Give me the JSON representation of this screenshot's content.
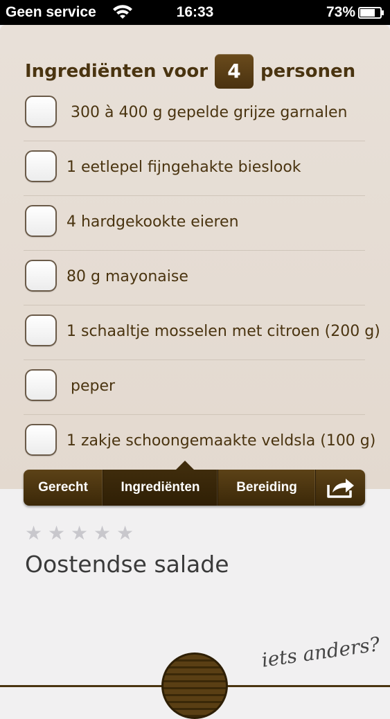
{
  "status_bar": {
    "carrier": "Geen service",
    "time": "16:33",
    "battery": "73%"
  },
  "heading": {
    "prefix": "Ingrediënten voor",
    "persons": "4",
    "suffix": "personen"
  },
  "ingredients": [
    {
      "text": "300 à 400 g gepelde grijze garnalen",
      "checked": false
    },
    {
      "text": "1 eetlepel fijngehakte bieslook",
      "checked": false
    },
    {
      "text": "4 hardgekookte eieren",
      "checked": false
    },
    {
      "text": "80 g mayonaise",
      "checked": false
    },
    {
      "text": "1 schaaltje mosselen met citroen (200 g)",
      "checked": false
    },
    {
      "text": "peper",
      "checked": false
    },
    {
      "text": "1 zakje schoongemaakte veldsla (100 g)",
      "checked": false
    }
  ],
  "tabs": {
    "gerecht": "Gerecht",
    "ingredienten": "Ingrediënten",
    "bereiding": "Bereiding",
    "active": "ingredienten"
  },
  "rating": {
    "value": 0,
    "max": 5
  },
  "recipe": {
    "title": "Oostendse salade"
  },
  "footer": {
    "other_label": "iets anders?"
  },
  "colors": {
    "brown_dark": "#3b2808",
    "brown_text": "#4a3410",
    "panel_bg": "#e6ded5"
  }
}
